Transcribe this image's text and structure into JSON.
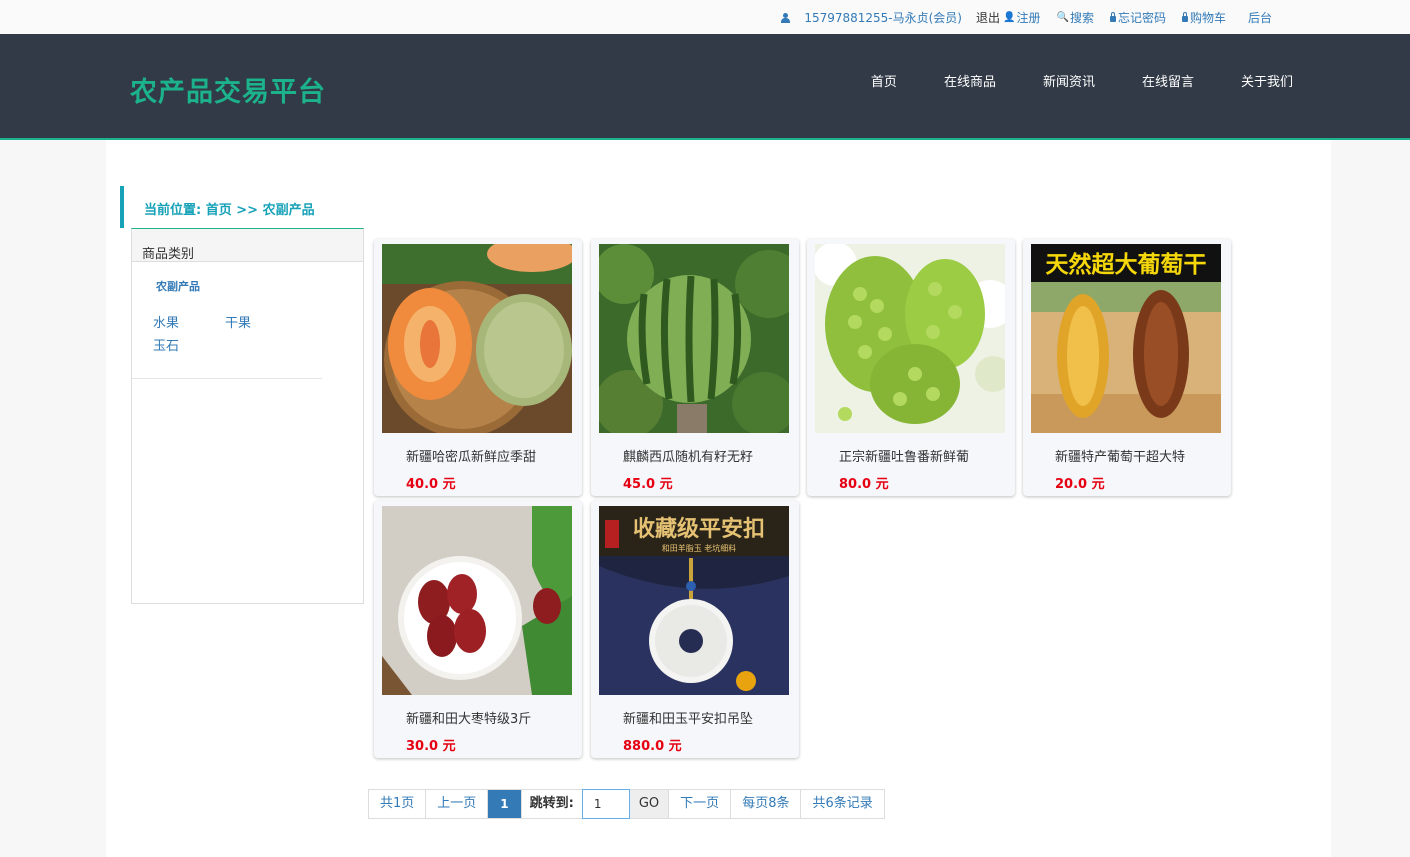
{
  "topbar": {
    "user": "15797881255-马永贞(会员)",
    "logout": "退出",
    "register": "注册",
    "search": "搜索",
    "forgot": "忘记密码",
    "cart": "购物车",
    "admin": "后台"
  },
  "header": {
    "logo": "农产品交易平台",
    "nav": [
      "首页",
      "在线商品",
      "新闻资讯",
      "在线留言",
      "关于我们"
    ]
  },
  "breadcrumb": {
    "prefix": "当前位置:",
    "home": "首页",
    "sep": ">>",
    "current": "农副产品"
  },
  "sidebar": {
    "title": "商品类别",
    "category": "农副产品",
    "subcategories": [
      "水果",
      "干果",
      "玉石"
    ]
  },
  "products": [
    {
      "name": "新疆哈密瓜新鲜应季甜",
      "price": "40.0 元"
    },
    {
      "name": "麒麟西瓜随机有籽无籽",
      "price": "45.0 元"
    },
    {
      "name": "正宗新疆吐鲁番新鲜葡",
      "price": "80.0 元"
    },
    {
      "name": "新疆特产葡萄干超大特",
      "price": "20.0 元"
    },
    {
      "name": "新疆和田大枣特级3斤",
      "price": "30.0 元"
    },
    {
      "name": "新疆和田玉平安扣吊坠",
      "price": "880.0 元"
    }
  ],
  "image_text": {
    "raisin_banner": "天然超大葡萄干",
    "jade_banner": "收藏级平安扣",
    "jade_sub": "和田羊脂玉 老坑细料"
  },
  "pagination": {
    "total_pages": "共1页",
    "prev": "上一页",
    "current": "1",
    "jump_label": "跳转到:",
    "jump_value": "1",
    "go": "GO",
    "next": "下一页",
    "per_page": "每页8条",
    "total_records": "共6条记录"
  }
}
